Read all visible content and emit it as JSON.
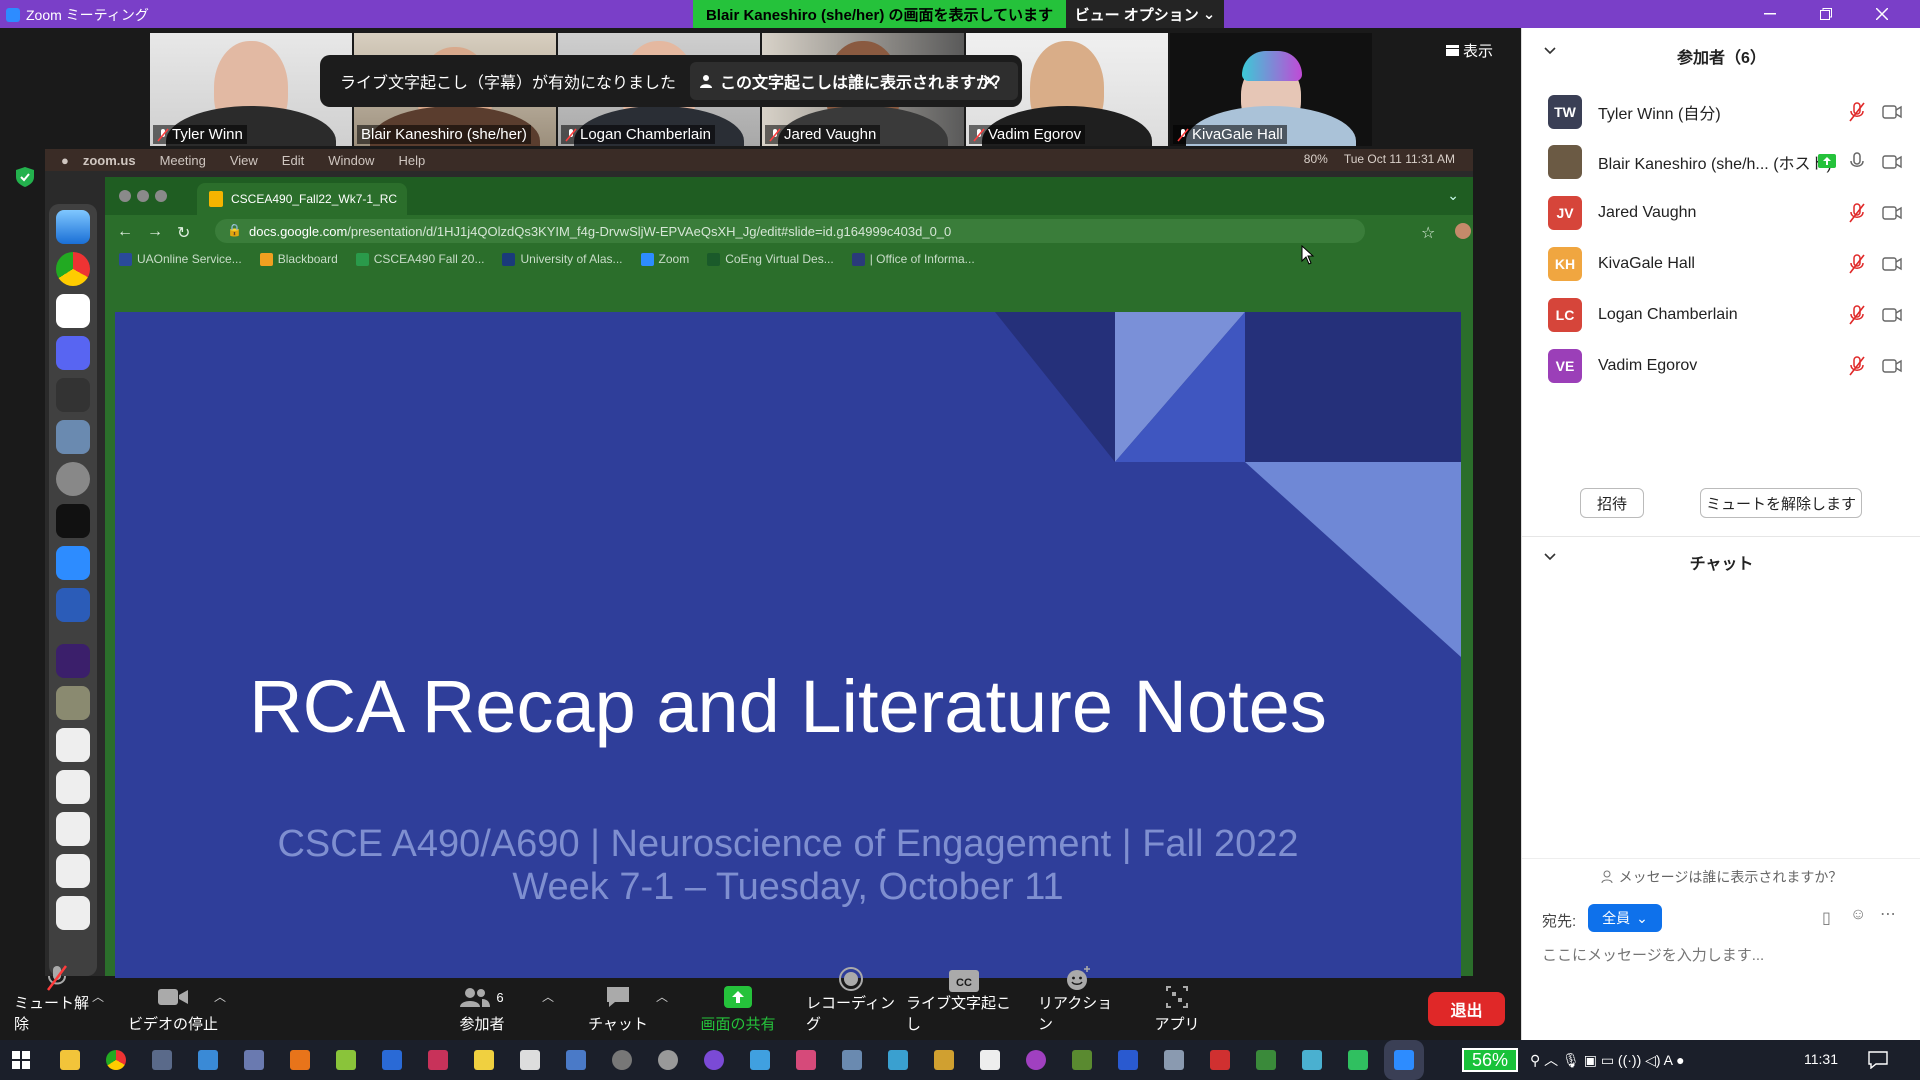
{
  "titlebar": {
    "app_title": "Zoom ミーティング"
  },
  "share_banner": {
    "text": "Blair Kaneshiro (she/her) の画面を表示しています",
    "view_options": "ビュー オプション"
  },
  "view_button": "表示",
  "thumbnails": [
    {
      "name": "Tyler Winn",
      "muted": true
    },
    {
      "name": "Blair Kaneshiro (she/her)",
      "muted": false
    },
    {
      "name": "Logan Chamberlain",
      "muted": true
    },
    {
      "name": "Jared Vaughn",
      "muted": true
    },
    {
      "name": "Vadim Egorov",
      "muted": true
    },
    {
      "name": "KivaGale Hall",
      "muted": true
    }
  ],
  "mac_menubar": {
    "items": [
      "zoom.us",
      "Meeting",
      "View",
      "Edit",
      "Window",
      "Help"
    ],
    "battery": "80%",
    "datetime": "Tue Oct 11  11:31 AM"
  },
  "browser": {
    "tab_title": "CSCEA490_Fall22_Wk7-1_RC",
    "url_host": "docs.google.com",
    "url_path": "/presentation/d/1HJ1j4QOlzdQs3KYIM_f4g-DrvwSljW-EPVAeQsXH_Jg/edit#slide=id.g164999c403d_0_0",
    "bookmarks": [
      "UAOnline Service...",
      "Blackboard",
      "CSCEA490 Fall 20...",
      "University of Alas...",
      "Zoom",
      "CoEng Virtual Des...",
      "| Office of Informa..."
    ]
  },
  "caption_banner": {
    "text": "ライブ文字起こし（字幕）が有効になりました",
    "question": "この文字起こしは誰に表示されますか？"
  },
  "slide": {
    "title": "RCA Recap and Literature Notes",
    "subtitle1": "CSCE A490/A690 | Neuroscience of Engagement | Fall 2022",
    "subtitle2": "Week 7-1 – Tuesday, October 11"
  },
  "toolbar": {
    "unmute": "ミュート解除",
    "stop_video": "ビデオの停止",
    "participants": "参加者",
    "participants_count": "6",
    "chat": "チャット",
    "share_screen": "画面の共有",
    "recording": "レコーディング",
    "live_transcript": "ライブ文字起こし",
    "reactions": "リアクション",
    "apps": "アプリ",
    "leave": "退出"
  },
  "panel": {
    "participants_title": "参加者（6）",
    "participants": [
      {
        "initials": "TW",
        "name": "Tyler Winn (自分)",
        "color": "#3a3f55"
      },
      {
        "initials": "",
        "name": "Blair Kaneshiro (she/h...  (ホスト)",
        "color": "#6b5a44"
      },
      {
        "initials": "JV",
        "name": "Jared Vaughn",
        "color": "#d6453a"
      },
      {
        "initials": "KH",
        "name": "KivaGale Hall",
        "color": "#f0a640"
      },
      {
        "initials": "LC",
        "name": "Logan Chamberlain",
        "color": "#d6453a"
      },
      {
        "initials": "VE",
        "name": "Vadim Egorov",
        "color": "#9b3fb8"
      }
    ],
    "invite": "招待",
    "unmute_all": "ミュートを解除します",
    "chat_title": "チャット",
    "chat_hint": "メッセージは誰に表示されますか？",
    "chat_to_label": "宛先:",
    "chat_to_value": "全員",
    "chat_placeholder": "ここにメッセージを入力します..."
  },
  "taskbar": {
    "battery_percent": "56%",
    "clock": "11:31"
  },
  "colors": {
    "zoom_purple": "#7a3fc8",
    "share_green": "#25c23b",
    "slide_blue": "#2f3e9a",
    "leave_red": "#e02828",
    "accent_blue": "#0e71eb"
  }
}
